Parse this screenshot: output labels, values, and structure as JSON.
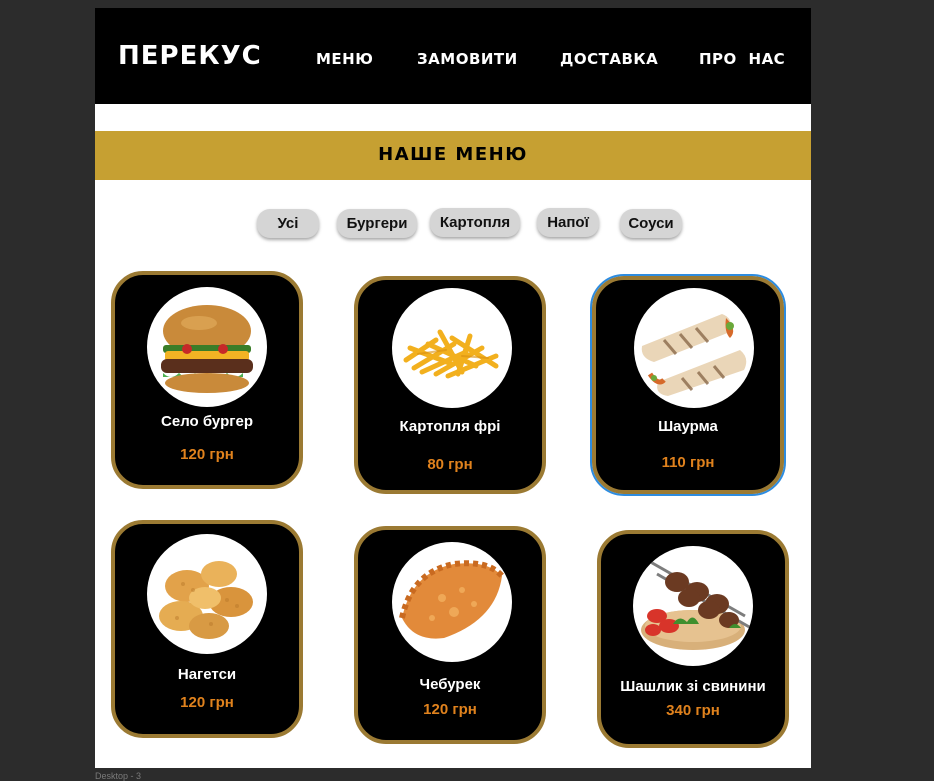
{
  "header": {
    "logo": "ПЕРЕКУС",
    "nav": [
      "МЕНЮ",
      "ЗАМОВИТИ",
      "ДОСТАВКА",
      "ПРО НАС"
    ]
  },
  "banner": {
    "title": "НАШЕ МЕНЮ"
  },
  "filters": [
    "Усі",
    "Бургери",
    "Картопля",
    "Напої",
    "Соуси"
  ],
  "items": [
    {
      "name": "Село бургер",
      "price": "120 грн",
      "icon": "burger-image"
    },
    {
      "name": "Картопля фрі",
      "price": "80 грн",
      "icon": "fries-image"
    },
    {
      "name": "Шаурма",
      "price": "110 грн",
      "icon": "shawarma-image"
    },
    {
      "name": "Нагетси",
      "price": "120 грн",
      "icon": "nuggets-image"
    },
    {
      "name": "Чебурек",
      "price": "120 грн",
      "icon": "chebureki-image"
    },
    {
      "name": "Шашлик зі свинини",
      "price": "340 грн",
      "icon": "shashlik-image"
    }
  ],
  "frame_label": "Desktop - 3",
  "colors": {
    "accent": "#c6a032",
    "card_border": "#9b7a33",
    "price": "#e0821d",
    "selection": "#2d8ce0"
  }
}
